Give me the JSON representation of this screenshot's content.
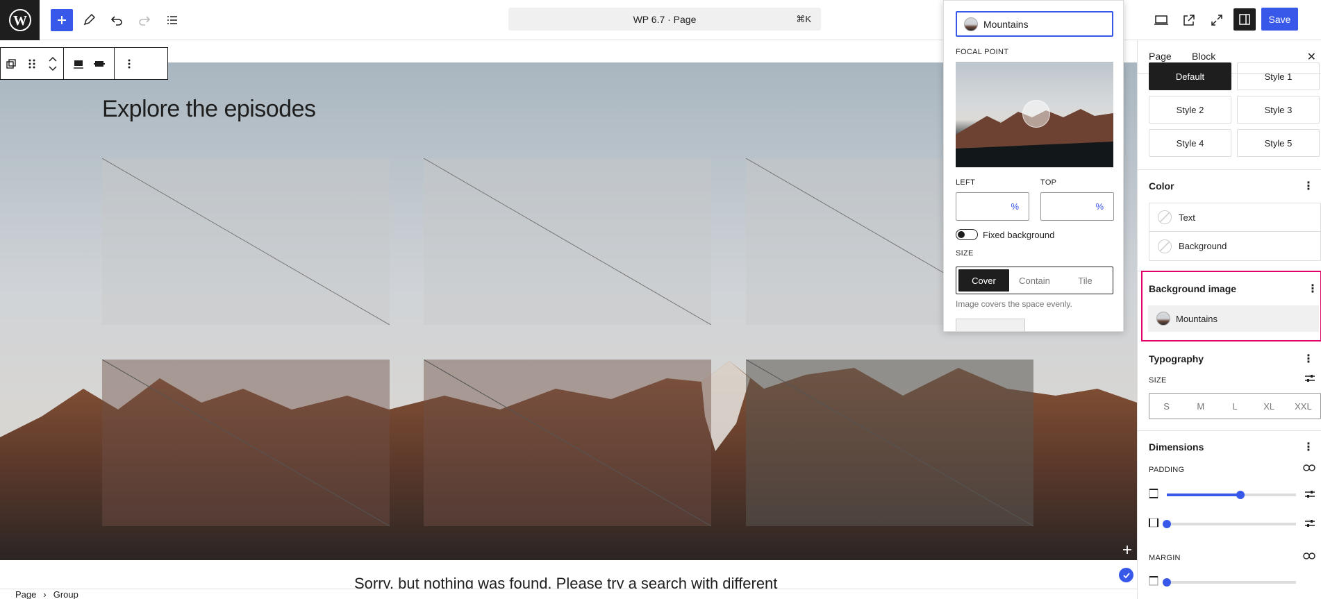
{
  "topbar": {
    "document_title": "WP 6.7 · Page",
    "shortcut": "⌘K",
    "save_label": "Save"
  },
  "canvas": {
    "heading": "Explore the episodes",
    "below_text": "Sorry, but nothing was found. Please try a search with different"
  },
  "breadcrumb": {
    "items": [
      "Page",
      "Group"
    ]
  },
  "popover": {
    "image_name": "Mountains",
    "focal_point_label": "FOCAL POINT",
    "left_label": "LEFT",
    "top_label": "TOP",
    "left_value": "",
    "top_value": "",
    "unit": "%",
    "fixed_background_label": "Fixed background",
    "size_label": "SIZE",
    "size_options": [
      "Cover",
      "Contain",
      "Tile"
    ],
    "size_selected": "Cover",
    "help_text": "Image covers the space evenly."
  },
  "sidebar": {
    "tabs": [
      "Page",
      "Block"
    ],
    "active_tab": "Block",
    "styles": [
      "Default",
      "Style 1",
      "Style 2",
      "Style 3",
      "Style 4",
      "Style 5"
    ],
    "active_style": "Default",
    "color_title": "Color",
    "color_items": [
      "Text",
      "Background"
    ],
    "bg_image_title": "Background image",
    "bg_image_name": "Mountains",
    "typography_title": "Typography",
    "size_label": "SIZE",
    "size_options": [
      "S",
      "M",
      "L",
      "XL",
      "XXL"
    ],
    "dimensions_title": "Dimensions",
    "padding_label": "PADDING",
    "margin_label": "MARGIN",
    "padding_values": [
      0.57,
      0.0
    ],
    "margin_value": 0.0
  },
  "colors": {
    "accent": "#3858e9",
    "highlight": "#e2006a",
    "dark": "#1e1e1e"
  }
}
